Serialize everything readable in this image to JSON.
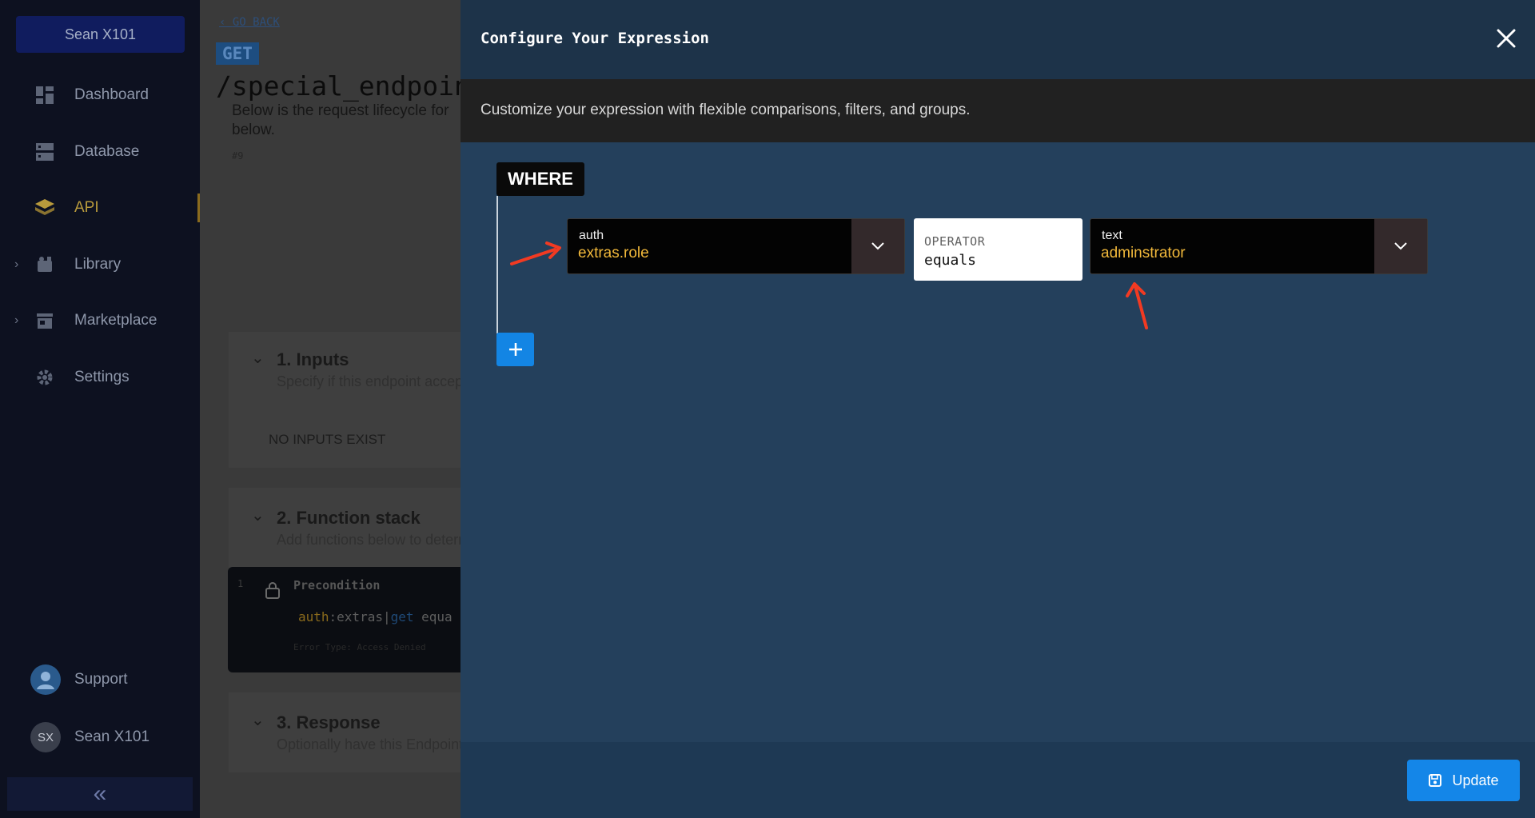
{
  "sidebar": {
    "workspace": "Sean X101",
    "items": [
      {
        "label": "Dashboard",
        "icon": "dashboard-icon"
      },
      {
        "label": "Database",
        "icon": "database-icon"
      },
      {
        "label": "API",
        "icon": "api-icon"
      },
      {
        "label": "Library",
        "icon": "library-icon"
      },
      {
        "label": "Marketplace",
        "icon": "marketplace-icon"
      },
      {
        "label": "Settings",
        "icon": "gear-icon"
      }
    ],
    "support_label": "Support",
    "user_initials": "SX",
    "user_name": "Sean X101"
  },
  "page": {
    "go_back": "GO BACK",
    "method": "GET",
    "endpoint": "/special_endpoint",
    "description": "Below is the request lifecycle for below.",
    "hash": "#9",
    "sections": [
      {
        "title": "1. Inputs",
        "subtitle": "Specify if this endpoint accepts"
      },
      {
        "title": "2. Function stack",
        "subtitle": "Add functions below to determine"
      },
      {
        "title": "3. Response",
        "subtitle": "Optionally have this Endpoint"
      }
    ],
    "no_inputs": "NO INPUTS EXIST",
    "function": {
      "number": "1",
      "title": "Precondition",
      "code_auth": "auth",
      "code_mid": ":extras|",
      "code_get": "get",
      "code_op": " equa",
      "error_type": "Error Type: Access Denied"
    }
  },
  "modal": {
    "title": "Configure Your Expression",
    "subtitle": "Customize your expression with flexible comparisons, filters, and groups.",
    "where_label": "WHERE",
    "left_operand": {
      "type": "auth",
      "value": "extras.role"
    },
    "operator": {
      "label": "OPERATOR",
      "value": "equals"
    },
    "right_operand": {
      "type": "text",
      "value": "adminstrator"
    },
    "update_label": "Update"
  },
  "colors": {
    "accent": "#1486e8",
    "modal_bg": "#24405c",
    "value_text": "#f2b93b",
    "annotation_arrow": "#f23a22"
  }
}
